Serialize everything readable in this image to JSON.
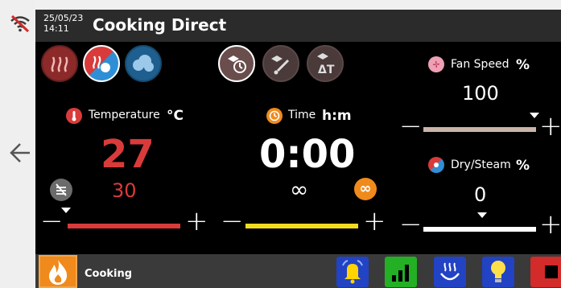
{
  "header": {
    "date": "25/05/23",
    "time": "14:11",
    "title": "Cooking Direct"
  },
  "modes": [
    "heat-icon",
    "combi-icon",
    "steam-icon"
  ],
  "probe_modes": [
    "timer-probe-icon",
    "core-probe-icon",
    "delta-t-icon"
  ],
  "temperature": {
    "label": "Temperature",
    "unit": "°C",
    "actual": "27",
    "setpoint": "30",
    "bar_level": 1.0,
    "bar_color": "#d93b3b"
  },
  "time": {
    "label": "Time",
    "unit": "h:m",
    "value": "0:00",
    "infinity": "∞",
    "infinity_badge": "∞",
    "bar_level": 1.0,
    "bar_color": "#f1dc1f"
  },
  "fan": {
    "label": "Fan Speed",
    "unit": "%",
    "value": "100",
    "bar_level": 1.0,
    "bar_color": "#c8b4a8"
  },
  "dry_steam": {
    "label": "Dry/Steam",
    "unit": "%",
    "value": "0",
    "bar_level": 1.0,
    "bar_color": "#ffffff"
  },
  "controls": {
    "minus": "−",
    "plus": "+"
  },
  "bottom": {
    "status_label": "Cooking"
  },
  "colors": {
    "accent_orange": "#f08a1c",
    "temp_red": "#d93b3b",
    "time_yellow": "#f1dc1f"
  }
}
